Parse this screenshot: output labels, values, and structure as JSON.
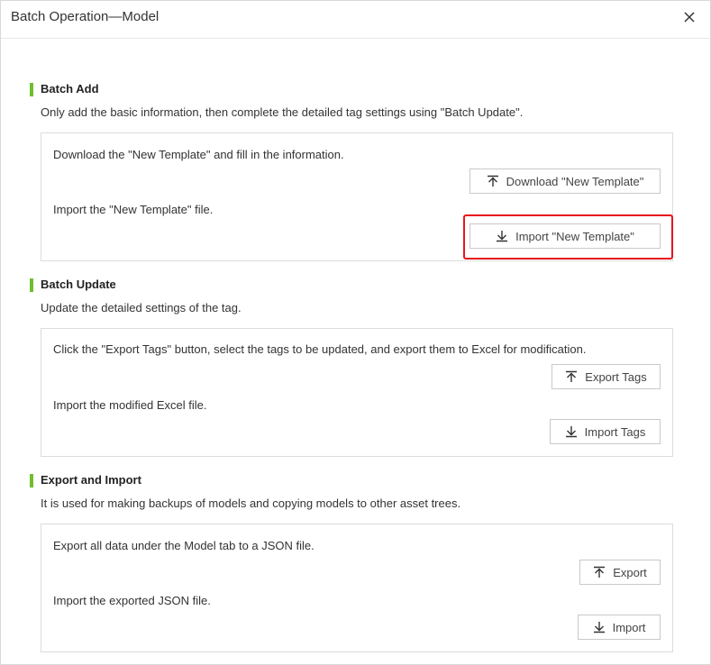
{
  "dialog": {
    "title": "Batch Operation—Model",
    "close_icon": "close-icon"
  },
  "batch_add": {
    "title": "Batch Add",
    "description": "Only add the basic information, then complete the detailed tag settings using \"Batch Update\".",
    "step1_text": "Download the \"New Template\" and fill in the information.",
    "download_button": "Download \"New Template\"",
    "step2_text": "Import the \"New Template\" file.",
    "import_button": "Import \"New Template\""
  },
  "batch_update": {
    "title": "Batch Update",
    "description": "Update the detailed settings of the tag.",
    "step1_text": "Click the \"Export Tags\" button, select the tags to be updated, and export them to Excel for modification.",
    "export_button": "Export Tags",
    "step2_text": "Import the modified Excel file.",
    "import_button": "Import Tags"
  },
  "export_import": {
    "title": "Export and Import",
    "description": "It is used for making backups of models and copying models to other asset trees.",
    "step1_text": "Export all data under the Model tab to a JSON file.",
    "export_button": "Export",
    "step2_text": "Import the exported JSON file.",
    "import_button": "Import"
  },
  "colors": {
    "section_bar": "#6fbe2e",
    "highlight": "#e8141c"
  }
}
